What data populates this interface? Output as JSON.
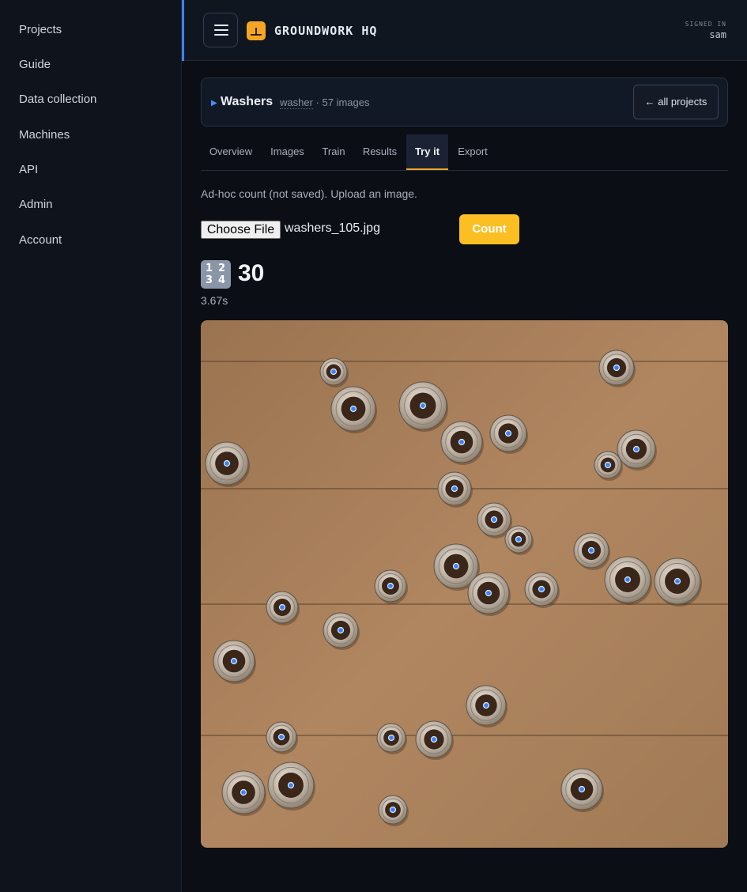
{
  "sidebar": {
    "items": [
      {
        "label": "Projects"
      },
      {
        "label": "Guide"
      },
      {
        "label": "Data collection"
      },
      {
        "label": "Machines"
      },
      {
        "label": "API"
      },
      {
        "label": "Admin"
      },
      {
        "label": "Account"
      }
    ]
  },
  "header": {
    "brand": "GROUNDWORK HQ",
    "signed_in_label": "SIGNED IN",
    "user": "sam",
    "menu_icon": "hamburger-menu-icon",
    "logo_icon": "groundwork-logo-icon",
    "accent_color": "#3b82f6",
    "logo_color": "#f5a524"
  },
  "project": {
    "name": "Washers",
    "class_name": "washer",
    "separator": "·",
    "image_count": "57 images",
    "back_label": "← all projects"
  },
  "tabs": [
    {
      "label": "Overview"
    },
    {
      "label": "Images"
    },
    {
      "label": "Train"
    },
    {
      "label": "Results"
    },
    {
      "label": "Try it",
      "active": true
    },
    {
      "label": "Export"
    }
  ],
  "tryit": {
    "hint": "Ad-hoc count (not saved). Upload an image.",
    "choose_file_label": "Choose File",
    "file_name": "washers_105.jpg",
    "count_button": "Count",
    "count_button_color": "#fbbf24",
    "result_icon": "numbers-1234-icon",
    "result_count": "30",
    "elapsed": "3.67s"
  }
}
